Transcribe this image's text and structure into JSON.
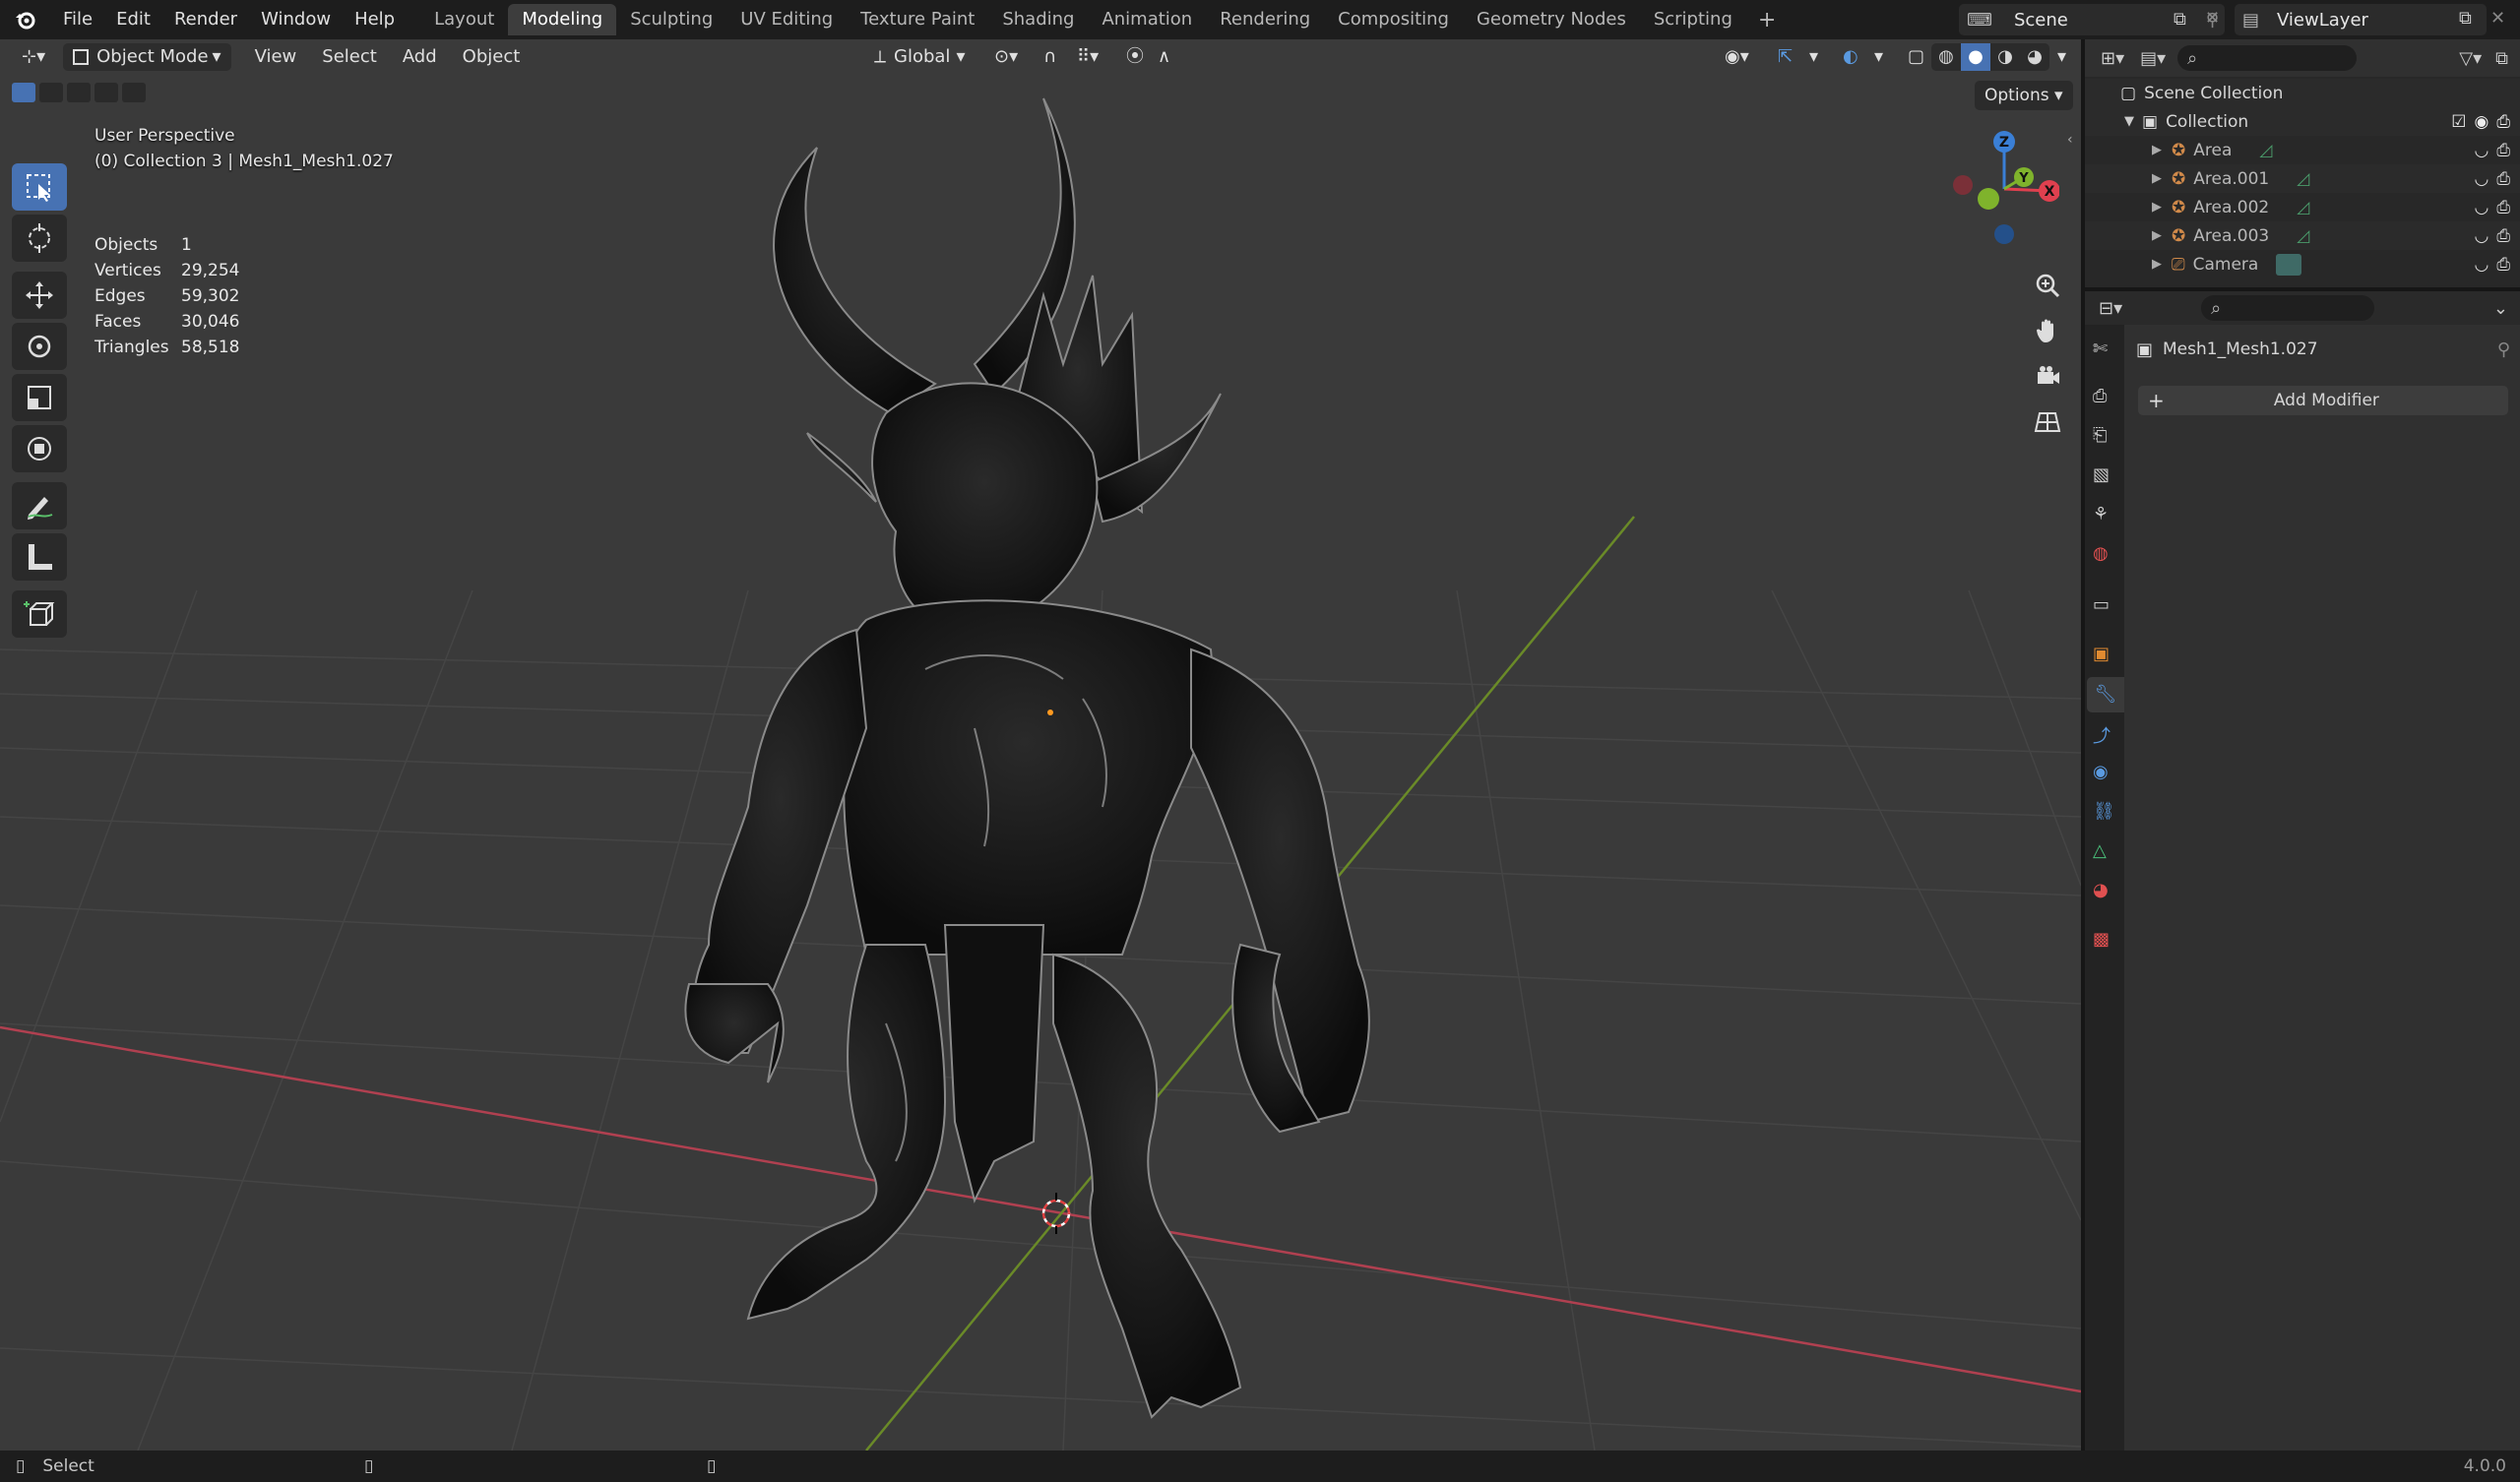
{
  "menu": {
    "items": [
      "File",
      "Edit",
      "Render",
      "Window",
      "Help"
    ]
  },
  "workspaces": {
    "tabs": [
      "Layout",
      "Modeling",
      "Sculpting",
      "UV Editing",
      "Texture Paint",
      "Shading",
      "Animation",
      "Rendering",
      "Compositing",
      "Geometry Nodes",
      "Scripting"
    ],
    "active": "Modeling"
  },
  "scene": {
    "name": "Scene",
    "view_layer": "ViewLayer"
  },
  "viewport_header": {
    "mode": "Object Mode",
    "menus": [
      "View",
      "Select",
      "Add",
      "Object"
    ],
    "orientation": "Global",
    "options_label": "Options"
  },
  "viewport": {
    "view_name": "User Perspective",
    "collection_info": "(0) Collection 3 | Mesh1_Mesh1.027",
    "stats": [
      {
        "label": "Objects",
        "value": "1"
      },
      {
        "label": "Vertices",
        "value": "29,254"
      },
      {
        "label": "Edges",
        "value": "59,302"
      },
      {
        "label": "Faces",
        "value": "30,046"
      },
      {
        "label": "Triangles",
        "value": "58,518"
      }
    ],
    "gizmo_axes": {
      "x": "X",
      "y": "Y",
      "z": "Z"
    }
  },
  "outliner": {
    "root": "Scene Collection",
    "collection": "Collection",
    "items": [
      "Area",
      "Area.001",
      "Area.002",
      "Area.003",
      "Camera"
    ]
  },
  "properties": {
    "object_name": "Mesh1_Mesh1.027",
    "add_modifier_label": "Add Modifier"
  },
  "statusbar": {
    "left_label": "Select",
    "version": "4.0.0"
  },
  "colors": {
    "accent": "#4772b3",
    "x_axis": "#e0404f",
    "y_axis": "#7fb32c",
    "z_axis": "#3a7fd6"
  }
}
